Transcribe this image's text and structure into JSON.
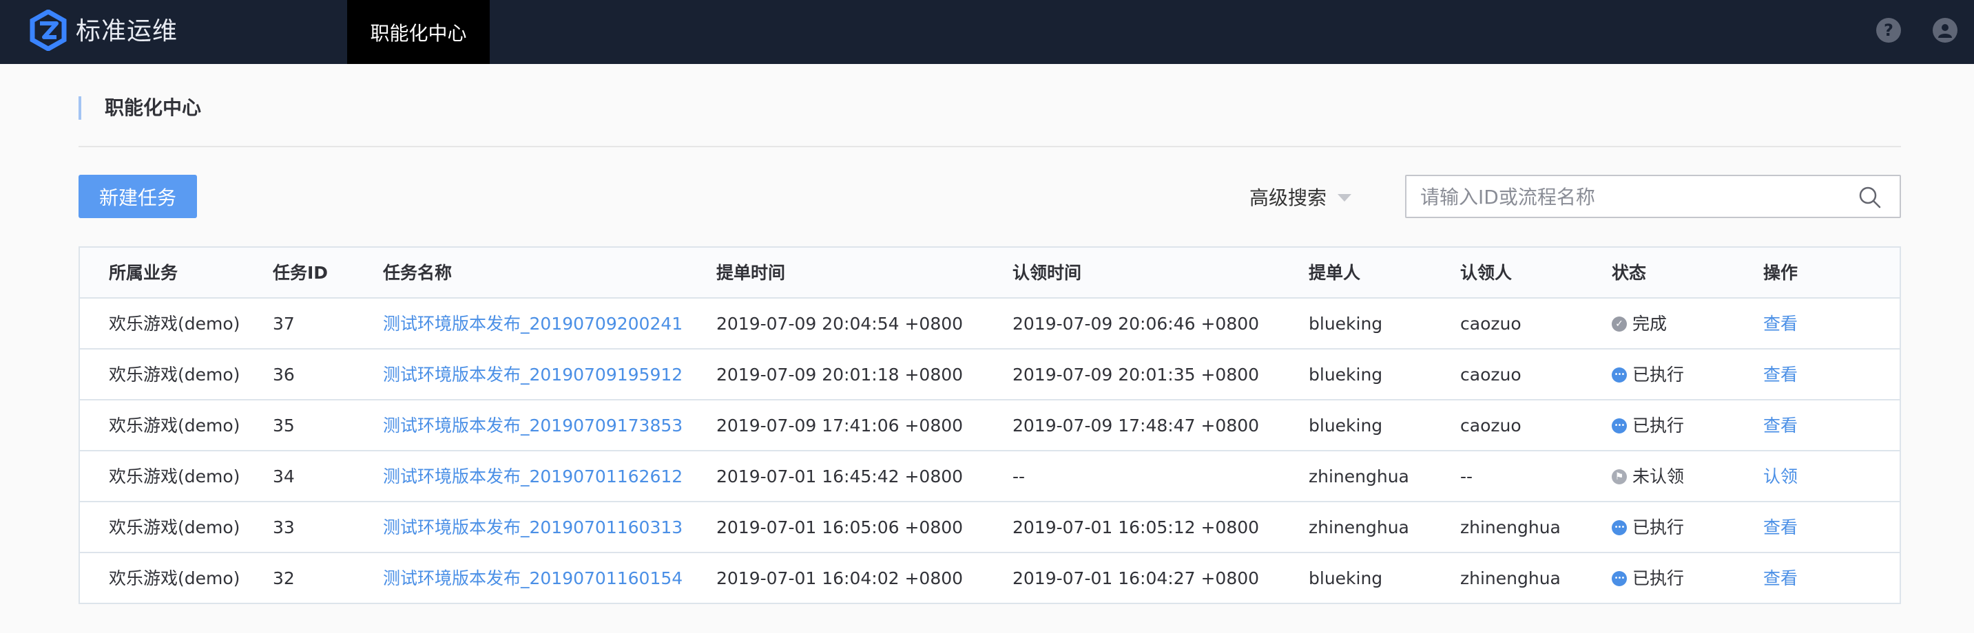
{
  "app": {
    "title": "标准运维",
    "nav_tab": "职能化中心"
  },
  "page": {
    "title": "职能化中心"
  },
  "toolbar": {
    "new_task_label": "新建任务",
    "advanced_search_label": "高级搜索",
    "search_placeholder": "请输入ID或流程名称",
    "search_value": ""
  },
  "table": {
    "columns": [
      "所属业务",
      "任务ID",
      "任务名称",
      "提单时间",
      "认领时间",
      "提单人",
      "认领人",
      "状态",
      "操作"
    ],
    "rows": [
      {
        "business": "欢乐游戏(demo)",
        "id": "37",
        "name": "测试环境版本发布_20190709200241",
        "submit_time": "2019-07-09 20:04:54 +0800",
        "claim_time": "2019-07-09 20:06:46 +0800",
        "submitter": "blueking",
        "claimer": "caozuo",
        "status": "完成",
        "status_type": "done",
        "action": "查看"
      },
      {
        "business": "欢乐游戏(demo)",
        "id": "36",
        "name": "测试环境版本发布_20190709195912",
        "submit_time": "2019-07-09 20:01:18 +0800",
        "claim_time": "2019-07-09 20:01:35 +0800",
        "submitter": "blueking",
        "claimer": "caozuo",
        "status": "已执行",
        "status_type": "run",
        "action": "查看"
      },
      {
        "business": "欢乐游戏(demo)",
        "id": "35",
        "name": "测试环境版本发布_20190709173853",
        "submit_time": "2019-07-09 17:41:06 +0800",
        "claim_time": "2019-07-09 17:48:47 +0800",
        "submitter": "blueking",
        "claimer": "caozuo",
        "status": "已执行",
        "status_type": "run",
        "action": "查看"
      },
      {
        "business": "欢乐游戏(demo)",
        "id": "34",
        "name": "测试环境版本发布_20190701162612",
        "submit_time": "2019-07-01 16:45:42 +0800",
        "claim_time": "--",
        "submitter": "zhinenghua",
        "claimer": "--",
        "status": "未认领",
        "status_type": "wait",
        "action": "认领"
      },
      {
        "business": "欢乐游戏(demo)",
        "id": "33",
        "name": "测试环境版本发布_20190701160313",
        "submit_time": "2019-07-01 16:05:06 +0800",
        "claim_time": "2019-07-01 16:05:12 +0800",
        "submitter": "zhinenghua",
        "claimer": "zhinenghua",
        "status": "已执行",
        "status_type": "run",
        "action": "查看"
      },
      {
        "business": "欢乐游戏(demo)",
        "id": "32",
        "name": "测试环境版本发布_20190701160154",
        "submit_time": "2019-07-01 16:04:02 +0800",
        "claim_time": "2019-07-01 16:04:27 +0800",
        "submitter": "blueking",
        "claimer": "zhinenghua",
        "status": "已执行",
        "status_type": "run",
        "action": "查看"
      }
    ]
  }
}
